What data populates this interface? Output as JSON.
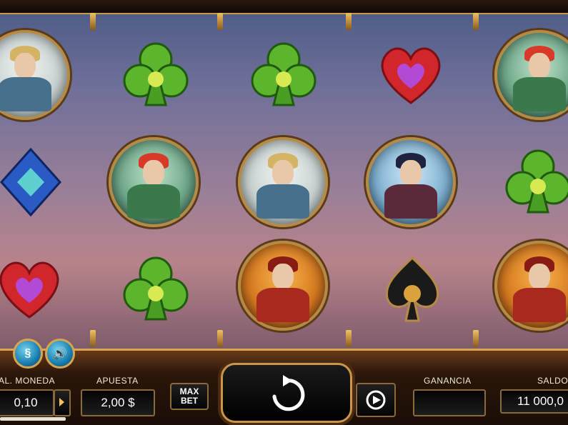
{
  "reels": {
    "row1": [
      {
        "symbol": "character-goggles-blonde",
        "name": "goggles-man-icon"
      },
      {
        "symbol": "club",
        "name": "green-club-icon"
      },
      {
        "symbol": "club",
        "name": "green-club-icon"
      },
      {
        "symbol": "heart",
        "name": "red-heart-icon"
      },
      {
        "symbol": "character-red-mohawk",
        "name": "mohawk-man-icon"
      }
    ],
    "row2": [
      {
        "symbol": "diamond",
        "name": "blue-diamond-icon"
      },
      {
        "symbol": "character-red-mohawk",
        "name": "mohawk-man-icon"
      },
      {
        "symbol": "character-goggles-blonde",
        "name": "goggles-man-icon"
      },
      {
        "symbol": "character-card-dealer",
        "name": "card-man-icon"
      },
      {
        "symbol": "club",
        "name": "green-club-icon"
      }
    ],
    "row3": [
      {
        "symbol": "heart",
        "name": "red-heart-icon"
      },
      {
        "symbol": "club",
        "name": "green-club-icon"
      },
      {
        "symbol": "character-tophat-boss",
        "name": "tophat-man-icon"
      },
      {
        "symbol": "spade",
        "name": "black-spade-icon"
      },
      {
        "symbol": "character-tophat-boss",
        "name": "tophat-man-icon"
      }
    ]
  },
  "controls": {
    "coin_label": "AL. MONEDA",
    "coin_value": "0,10",
    "bet_label": "APUESTA",
    "bet_value": "2,00 $",
    "maxbet_line1": "MAX",
    "maxbet_line2": "BET",
    "win_label": "GANANCIA",
    "win_value": "",
    "balance_label": "SALDO",
    "balance_value": "11 000,0"
  },
  "buttons": {
    "paytable_symbol": "§",
    "sound_symbol": "🔊"
  },
  "colors": {
    "club_green": "#5db52d",
    "heart_red": "#d1262c",
    "diamond_blue": "#2a5bc4",
    "spade_black": "#1a1a1a",
    "gold": "#d9a654"
  }
}
